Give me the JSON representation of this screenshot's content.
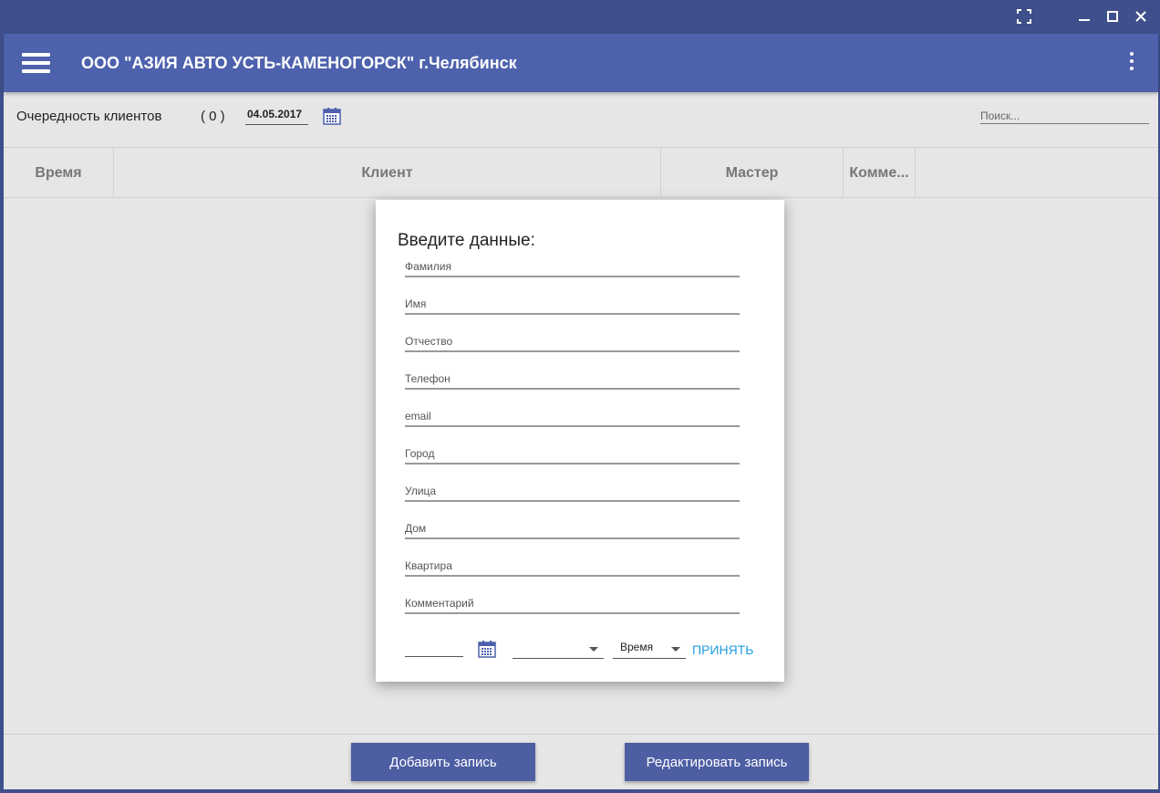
{
  "app": {
    "title": "ООО \"АЗИЯ АВТО УСТЬ-КАМЕНОГОРСК\" г.Челябинск"
  },
  "toolbar": {
    "queue_label": "Очередность клиентов",
    "queue_count": "( 0 )",
    "date": "04.05.2017",
    "search_placeholder": "Поиск..."
  },
  "table": {
    "columns": [
      "Время",
      "Клиент",
      "Мастер",
      "Комме..."
    ]
  },
  "dialog": {
    "title": "Введите данные:",
    "fields": [
      "Фамилия",
      "Имя",
      "Отчество",
      "Телефон",
      "email",
      "Город",
      "Улица",
      "Дом",
      "Квартира",
      "Комментарий"
    ],
    "date_value": "",
    "master_select_value": "",
    "time_select_value": "Время",
    "accept_label": "ПРИНЯТЬ"
  },
  "footer": {
    "add_label": "Добавить запись",
    "edit_label": "Редактировать запись"
  },
  "colors": {
    "appbar": "#4d61ad",
    "button": "#4d5ea3",
    "accent_link": "#1e9de3",
    "window_frame": "#3f4f8c"
  },
  "icons": [
    "fullscreen-icon",
    "minimize-icon",
    "maximize-icon",
    "close-icon",
    "menu-icon",
    "more-vert-icon",
    "calendar-icon"
  ]
}
